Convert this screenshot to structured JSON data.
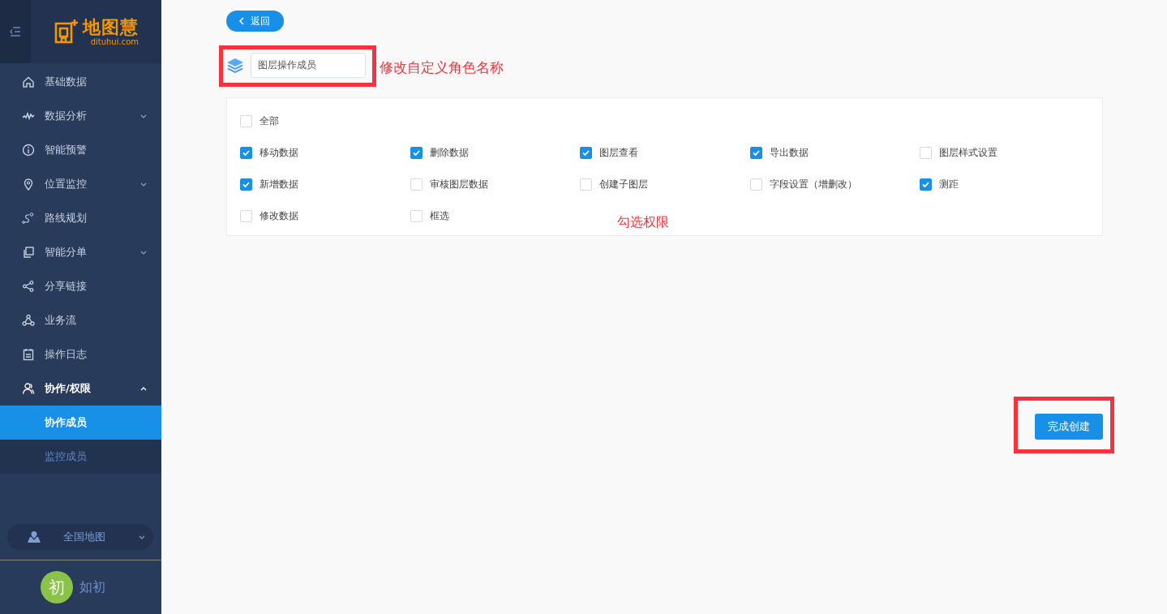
{
  "sidebar": {
    "logo": {
      "name": "地图慧",
      "domain": "dituhui.com"
    },
    "items": [
      {
        "label": "基础数据"
      },
      {
        "label": "数据分析",
        "expanded": false
      },
      {
        "label": "智能预警"
      },
      {
        "label": "位置监控",
        "expanded": false
      },
      {
        "label": "路线规划"
      },
      {
        "label": "智能分单",
        "expanded": false
      },
      {
        "label": "分享链接"
      },
      {
        "label": "业务流"
      },
      {
        "label": "操作日志"
      },
      {
        "label": "协作/权限",
        "expanded": true,
        "children": [
          {
            "label": "协作成员",
            "selected": true
          },
          {
            "label": "监控成员",
            "selected": false
          }
        ]
      }
    ],
    "map_selector": {
      "label": "全国地图"
    },
    "user": {
      "avatar": "初",
      "name": "如初"
    }
  },
  "main": {
    "back_button": "返回",
    "role_name": {
      "value": "图层操作成员"
    },
    "name_annotation": "修改自定义角色名称",
    "permissions": {
      "all": {
        "label": "全部",
        "checked": false
      },
      "items": [
        {
          "label": "移动数据",
          "checked": true
        },
        {
          "label": "删除数据",
          "checked": true
        },
        {
          "label": "图层查看",
          "checked": true
        },
        {
          "label": "导出数据",
          "checked": true
        },
        {
          "label": "图层样式设置",
          "checked": false
        },
        {
          "label": "新增数据",
          "checked": true
        },
        {
          "label": "审核图层数据",
          "checked": false
        },
        {
          "label": "创建子图层",
          "checked": false
        },
        {
          "label": "字段设置（增删改）",
          "checked": false
        },
        {
          "label": "测距",
          "checked": true
        },
        {
          "label": "修改数据",
          "checked": false
        },
        {
          "label": "框选",
          "checked": false
        }
      ]
    },
    "permissions_annotation": "勾选权限",
    "submit_button": "完成创建"
  }
}
